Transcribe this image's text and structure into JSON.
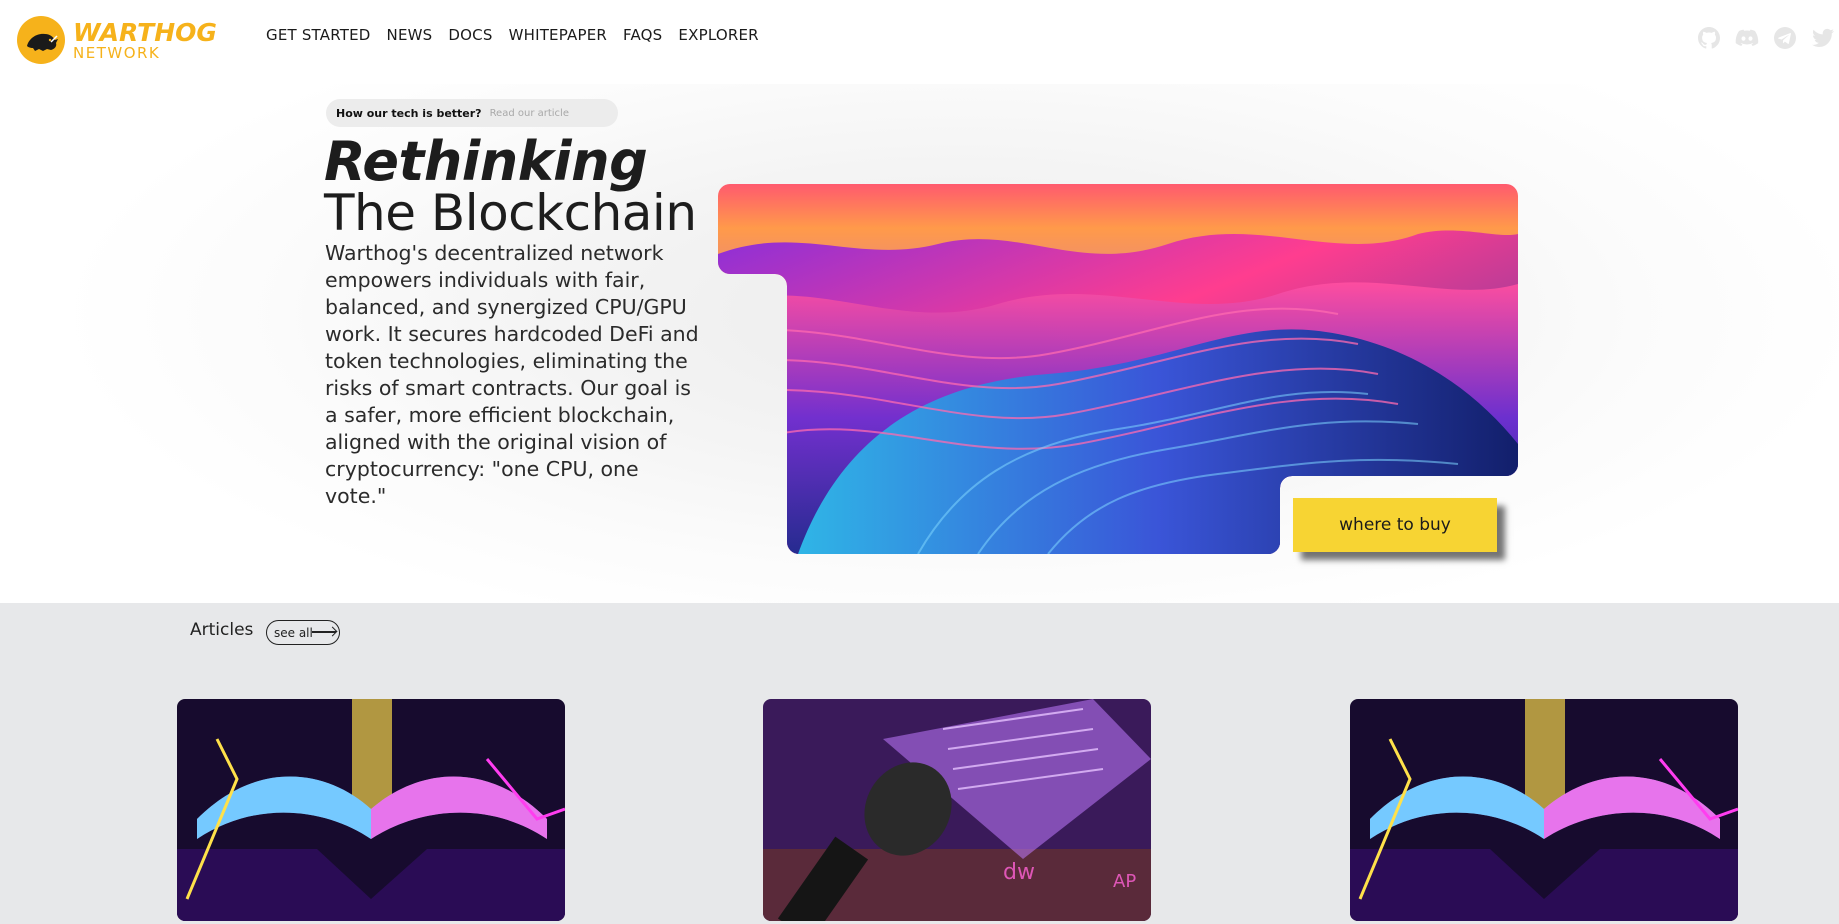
{
  "nav": {
    "logo_title": "WARTHOG",
    "logo_subtitle": "NETWORK",
    "links": [
      "GET STARTED",
      "NEWS",
      "DOCS",
      "WHITEPAPER",
      "FAQS",
      "EXPLORER"
    ],
    "social_icons": [
      "github-icon",
      "discord-icon",
      "telegram-icon",
      "twitter-icon"
    ]
  },
  "hero": {
    "pill_text": "How our tech is better?",
    "pill_link": "Read our article",
    "title_italic": "Rethinking",
    "title_regular": "The Blockchain",
    "description": "Warthog's decentralized network empowers individuals with fair, balanced, and synergized CPU/GPU work. It secures hardcoded DeFi and token technologies, eliminating the risks of smart contracts. Our goal is a safer, more efficient blockchain, aligned with the original vision of cryptocurrency: \"one CPU, one vote.\"",
    "buy_button": "where to buy"
  },
  "articles": {
    "title": "Articles",
    "see_all": "see all"
  },
  "colors": {
    "brand": "#f6b21b",
    "button": "#f7d433",
    "articles_bg": "#e7e8ea"
  }
}
